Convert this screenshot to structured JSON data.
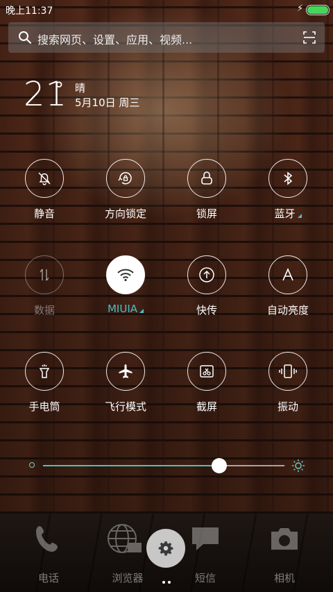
{
  "status": {
    "time": "晚上11:37",
    "battery_level": 1.0
  },
  "search": {
    "placeholder": "搜索网页、设置、应用、视频..."
  },
  "weather": {
    "temperature": "21",
    "degree": "°",
    "condition": "晴",
    "date": "5月10日 周三"
  },
  "toggles": [
    {
      "label": "静音",
      "icon": "bell-off-icon",
      "state": "off"
    },
    {
      "label": "方向锁定",
      "icon": "rotation-lock-icon",
      "state": "off"
    },
    {
      "label": "锁屏",
      "icon": "lock-icon",
      "state": "off"
    },
    {
      "label": "蓝牙",
      "icon": "bluetooth-icon",
      "state": "off"
    },
    {
      "label": "数据",
      "icon": "mobile-data-icon",
      "state": "disabled"
    },
    {
      "label": "MIUIA",
      "icon": "wifi-icon",
      "state": "on"
    },
    {
      "label": "快传",
      "icon": "share-icon",
      "state": "off"
    },
    {
      "label": "自动亮度",
      "icon": "auto-brightness-icon",
      "state": "off"
    },
    {
      "label": "手电筒",
      "icon": "flashlight-icon",
      "state": "off"
    },
    {
      "label": "飞行模式",
      "icon": "airplane-icon",
      "state": "off"
    },
    {
      "label": "截屏",
      "icon": "screenshot-icon",
      "state": "off"
    },
    {
      "label": "振动",
      "icon": "vibrate-icon",
      "state": "off"
    }
  ],
  "brightness": {
    "level": 0.73
  },
  "dock": {
    "items": [
      {
        "label": "电话",
        "icon": "phone-icon"
      },
      {
        "label": "浏览器",
        "icon": "browser-icon"
      },
      {
        "label": "短信",
        "icon": "message-icon"
      },
      {
        "label": "相机",
        "icon": "camera-icon"
      }
    ],
    "center_icon": "gear-icon"
  },
  "colors": {
    "accent": "#4ac1c6",
    "battery": "#44d85a"
  }
}
